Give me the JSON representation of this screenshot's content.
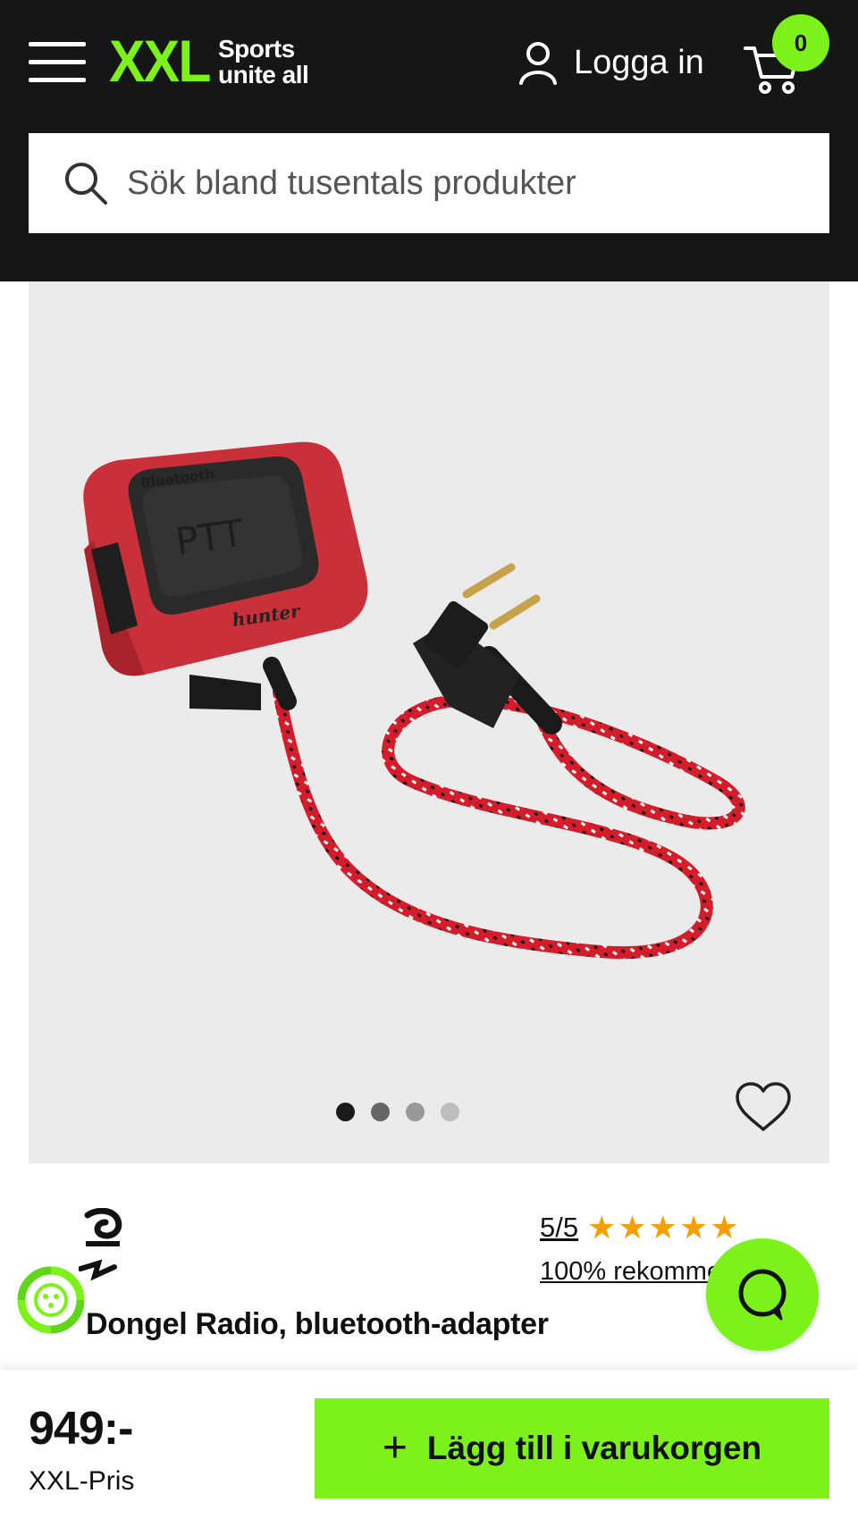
{
  "header": {
    "logo_mark": "XXL",
    "logo_tagline_1": "Sports",
    "logo_tagline_2": "unite all",
    "login_label": "Logga in",
    "cart_count": "0",
    "icons": {
      "menu": "hamburger-icon",
      "user": "user-icon",
      "cart": "cart-icon",
      "search": "search-icon"
    }
  },
  "search": {
    "placeholder": "Sök bland tusentals produkter"
  },
  "gallery": {
    "image_count": 4,
    "active_index": 0,
    "dot_colors": [
      "#1a1a1a",
      "#666666",
      "#999999",
      "#bdbdbd"
    ],
    "product_label_ptt": "PTT",
    "product_label_bluetooth": "Bluetooth",
    "product_label_brand": "hunter"
  },
  "product": {
    "title": "Dongel Radio, bluetooth-adapter",
    "rating_text": "5/5",
    "stars": 5,
    "recommend_text": "100% rekommenderar"
  },
  "purchase": {
    "price": "949:-",
    "price_label": "XXL-Pris",
    "add_to_cart_label": "Lägg till i varukorgen"
  },
  "colors": {
    "accent": "#7cf21a",
    "header_bg": "#161616",
    "gallery_bg": "#ebebeb",
    "star": "#f5a000"
  }
}
